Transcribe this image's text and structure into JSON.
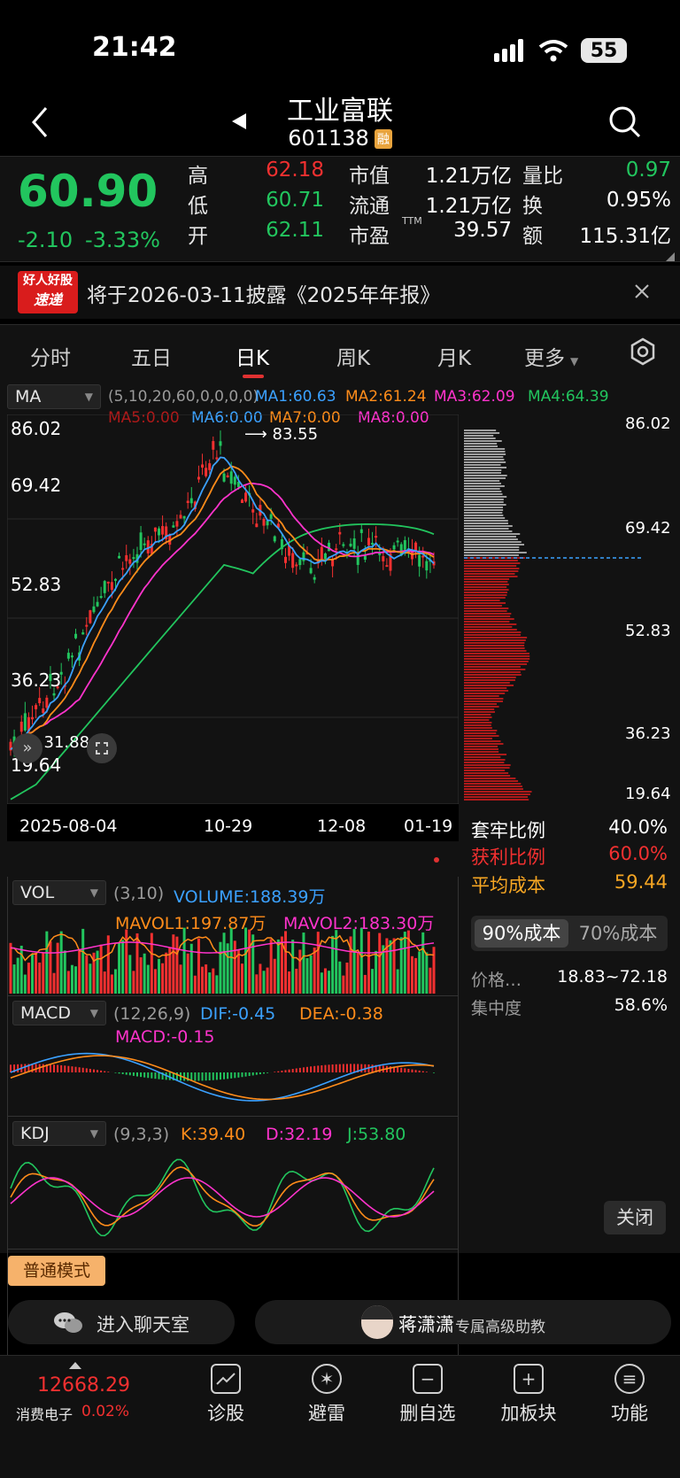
{
  "status": {
    "time": "21:42",
    "battery": "55"
  },
  "nav": {
    "title": "工业富联",
    "code": "601138",
    "badge": "融"
  },
  "quote": {
    "price": "60.90",
    "change": "-2.10",
    "change_pct": "-3.33%",
    "high_label": "高",
    "high": "62.18",
    "low_label": "低",
    "low": "60.71",
    "open_label": "开",
    "open": "62.11",
    "mktcap_label": "市值",
    "mktcap": "1.21万亿",
    "float_label": "流通",
    "float": "1.21万亿",
    "pe_label": "市盈",
    "pe_tag": "TTM",
    "pe": "39.57",
    "vol_ratio_label": "量比",
    "vol_ratio": "0.97",
    "turnover_label": "换",
    "turnover": "0.95%",
    "amount_label": "额",
    "amount": "115.31亿"
  },
  "notice": {
    "logo_top": "好人好股",
    "logo_bottom": "速递",
    "text": "将于2026-03-11披露《2025年年报》"
  },
  "tabs": [
    "分时",
    "五日",
    "日K",
    "周K",
    "月K",
    "更多"
  ],
  "ma": {
    "selector": "MA",
    "params": "(5,10,20,60,0,0,0,0)",
    "ma1": "MA1:60.63",
    "ma2": "MA2:61.24",
    "ma3": "MA3:62.09",
    "ma4": "MA4:64.39",
    "ma5": "MA5:0.00",
    "ma6": "MA6:0.00",
    "ma7": "MA7:0.00",
    "ma8": "MA8:0.00"
  },
  "kline": {
    "y_labels": [
      "86.02",
      "69.42",
      "52.83",
      "36.23",
      "19.64"
    ],
    "max_marker": "83.55",
    "min_marker": "31.88",
    "x_labels": [
      "2025-08-04",
      "10-29",
      "12-08",
      "01-19"
    ]
  },
  "chip": {
    "y_labels": [
      "86.02",
      "69.42",
      "52.83",
      "36.23",
      "19.64"
    ],
    "trap_label": "套牢比例",
    "trap": "40.0%",
    "profit_label": "获利比例",
    "profit": "60.0%",
    "avg_label": "平均成本",
    "avg": "59.44",
    "btn90": "90%成本",
    "btn70": "70%成本",
    "range_label": "价格…",
    "range": "18.83~72.18",
    "conc_label": "集中度",
    "conc": "58.6%",
    "close": "关闭"
  },
  "vol": {
    "selector": "VOL",
    "params": "(3,10)",
    "volume": "VOLUME:188.39万",
    "mavol1": "MAVOL1:197.87万",
    "mavol2": "MAVOL2:183.30万"
  },
  "macd": {
    "selector": "MACD",
    "params": "(12,26,9)",
    "dif": "DIF:-0.45",
    "dea": "DEA:-0.38",
    "macd": "MACD:-0.15"
  },
  "kdj": {
    "selector": "KDJ",
    "params": "(9,3,3)",
    "k": "K:39.40",
    "d": "D:32.19",
    "j": "J:53.80"
  },
  "mode": "普通模式",
  "chat": {
    "room": "进入聊天室",
    "assistant_name": "蒋潇潇",
    "assistant_role": "专属高级助教"
  },
  "bottom": {
    "index_value": "12668.29",
    "index_name": "消费电子",
    "index_change": "0.02%",
    "tools": [
      "诊股",
      "避雷",
      "删自选",
      "加板块",
      "功能"
    ]
  }
}
